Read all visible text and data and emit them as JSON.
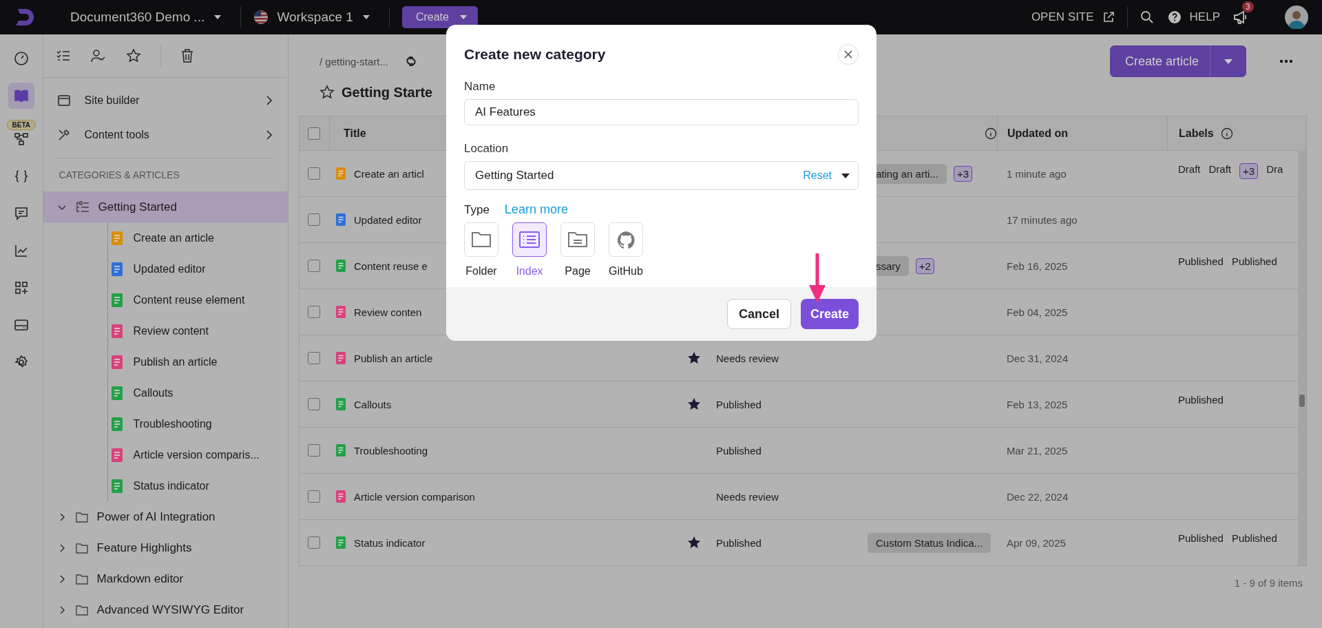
{
  "top_bar": {
    "project": "Document360 Demo ...",
    "workspace": "Workspace 1",
    "create_button": "Create",
    "open_site": "OPEN SITE",
    "help": "HELP",
    "notification_count": "3"
  },
  "rail": [
    {
      "selected": false
    },
    {
      "selected": true
    },
    {
      "selected": false,
      "badge": "BETA"
    },
    {
      "selected": false
    },
    {
      "selected": false
    },
    {
      "selected": false
    },
    {
      "selected": false
    },
    {
      "selected": false
    },
    {
      "selected": false
    }
  ],
  "sidebar": {
    "menu": [
      "Site builder",
      "Content tools"
    ],
    "section_title": "CATEGORIES & ARTICLES",
    "tree": [
      {
        "label": "Getting Started",
        "kind": "category",
        "expanded": true,
        "selected": true,
        "children": [
          {
            "label": "Create an article",
            "color": "#d98e0b"
          },
          {
            "label": "Updated editor",
            "color": "#2e6fd8"
          },
          {
            "label": "Content reuse element",
            "color": "#24a049"
          },
          {
            "label": "Review content",
            "color": "#d8427c"
          },
          {
            "label": "Publish an article",
            "color": "#d8427c"
          },
          {
            "label": "Callouts",
            "color": "#24a049"
          },
          {
            "label": "Troubleshooting",
            "color": "#24a049"
          },
          {
            "label": "Article version comparis...",
            "color": "#d8427c"
          },
          {
            "label": "Status indicator",
            "color": "#24a049"
          }
        ]
      },
      {
        "label": "Power of AI Integration",
        "kind": "folder",
        "expanded": false,
        "selected": false
      },
      {
        "label": "Feature Highlights",
        "kind": "folder",
        "expanded": false,
        "selected": false
      },
      {
        "label": "Markdown editor",
        "kind": "folder",
        "expanded": false,
        "selected": false
      },
      {
        "label": "Advanced WYSIWYG Editor",
        "kind": "folder",
        "expanded": false,
        "selected": false
      }
    ]
  },
  "main": {
    "breadcrumb": "/ getting-start...",
    "title": "Getting Starte",
    "create_article": "Create article",
    "table": {
      "columns": {
        "title": "Title",
        "updated_on": "Updated on",
        "labels": "Labels"
      },
      "header_checked": false,
      "rows": [
        {
          "checked": false,
          "title": "Create an articl",
          "color": "#d98e0b",
          "tags": [
            {
              "text": "ating an arti...",
              "kind": "tag"
            },
            {
              "text": "+3",
              "kind": "count"
            }
          ],
          "updated": "1 minute ago",
          "labels": [
            {
              "text": "Draft",
              "kind": "label"
            },
            {
              "text": "Draft",
              "kind": "label"
            },
            {
              "text": "+3",
              "kind": "count"
            },
            {
              "text": "Dra",
              "kind": "label"
            }
          ]
        },
        {
          "checked": false,
          "title": "Updated editor",
          "color": "#2e6fd8",
          "updated": "17 minutes ago"
        },
        {
          "checked": false,
          "title": "Content reuse e",
          "color": "#24a049",
          "tags": [
            {
              "text": "ssary",
              "kind": "tag"
            },
            {
              "text": "+2",
              "kind": "count"
            }
          ],
          "updated": "Feb 16, 2025",
          "labels": [
            {
              "text": "Published",
              "kind": "label"
            },
            {
              "text": "Published",
              "kind": "label"
            }
          ]
        },
        {
          "checked": false,
          "title": "Review conten",
          "color": "#d8427c",
          "updated": "Feb 04, 2025"
        },
        {
          "checked": false,
          "title": "Publish an article",
          "color": "#d8427c",
          "starred": true,
          "status": "Needs review",
          "updated": "Dec 31, 2024"
        },
        {
          "checked": false,
          "title": "Callouts",
          "color": "#24a049",
          "starred": true,
          "status": "Published",
          "updated": "Feb 13, 2025",
          "labels": [
            {
              "text": "Published",
              "kind": "label"
            }
          ]
        },
        {
          "checked": false,
          "title": "Troubleshooting",
          "color": "#24a049",
          "starred": false,
          "status": "Published",
          "updated": "Mar 21, 2025"
        },
        {
          "checked": false,
          "title": "Article version comparison",
          "color": "#d8427c",
          "starred": false,
          "status": "Needs review",
          "updated": "Dec 22, 2024"
        },
        {
          "checked": false,
          "title": "Status indicator",
          "color": "#24a049",
          "starred": true,
          "status": "Published",
          "tags": [
            {
              "text": "Custom Status Indica...",
              "kind": "tag"
            }
          ],
          "updated": "Apr 09, 2025",
          "labels": [
            {
              "text": "Published",
              "kind": "label"
            },
            {
              "text": "Published",
              "kind": "label"
            }
          ]
        }
      ]
    },
    "pagination": "1 - 9 of 9 items"
  },
  "dialog": {
    "title": "Create new category",
    "name_label": "Name",
    "name_value": "AI Features",
    "location_label": "Location",
    "location_value": "Getting Started",
    "reset": "Reset",
    "type_label": "Type",
    "learn_more": "Learn more",
    "types": [
      {
        "label": "Folder",
        "selected": false
      },
      {
        "label": "Index",
        "selected": true
      },
      {
        "label": "Page",
        "selected": false
      },
      {
        "label": "GitHub",
        "selected": false
      }
    ],
    "cancel": "Cancel",
    "create": "Create"
  }
}
